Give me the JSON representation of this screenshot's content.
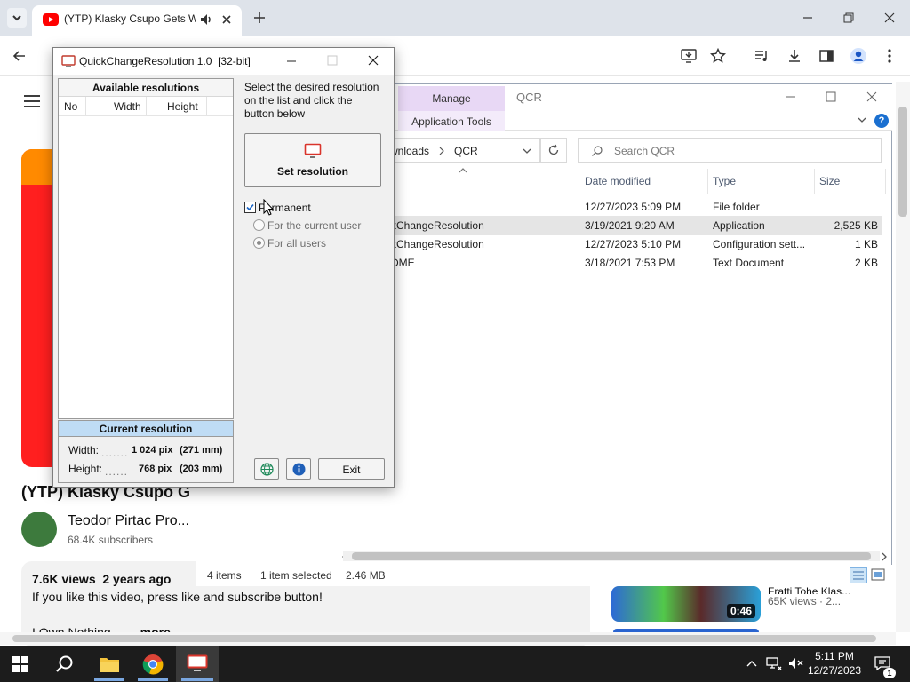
{
  "chrome": {
    "tab_title": "(YTP) Klasky Csupo Gets We",
    "colors": {
      "tabbar": "#dee3ea",
      "youtube_red": "#ff0000"
    }
  },
  "youtube": {
    "video_title": "(YTP) Klasky Csupo G",
    "channel_name": "Teodor Pirtac Pro...",
    "subscribers": "68.4K subscribers",
    "stats": "7.6K views  2 years ago",
    "description": "If you like this video, press like and subscribe button!",
    "description_more_line": "I Own Nothing",
    "more_label": "...more",
    "side_video": {
      "title": "Fratti Tohe Klas...",
      "views": "65K views · 2...",
      "duration": "0:46"
    }
  },
  "explorer": {
    "manage_tab": "Manage",
    "app_tools_tab": "Application Tools",
    "window_title": "QCR",
    "address": {
      "segment1": "wnloads",
      "segment2": "QCR"
    },
    "search_placeholder": "Search QCR",
    "columns": {
      "date": "Date modified",
      "type": "Type",
      "size": "Size"
    },
    "files": [
      {
        "name": "",
        "date": "12/27/2023 5:09 PM",
        "type": "File folder",
        "size": ""
      },
      {
        "name": "kChangeResolution",
        "date": "3/19/2021 9:20 AM",
        "type": "Application",
        "size": "2,525 KB"
      },
      {
        "name": "kChangeResolution",
        "date": "12/27/2023 5:10 PM",
        "type": "Configuration sett...",
        "size": "1 KB"
      },
      {
        "name": "DME",
        "date": "3/18/2021 7:53 PM",
        "type": "Text Document",
        "size": "2 KB"
      }
    ],
    "status": {
      "items": "4 items",
      "selected": "1 item selected",
      "selected_size": "2.46 MB"
    }
  },
  "qcr": {
    "title": "QuickChangeResolution 1.0  [32-bit]",
    "available_header": "Available resolutions",
    "col_no": "No",
    "col_width": "Width",
    "col_height": "Height",
    "instruction": "Select the desired resolution on the list and click the button below",
    "set_button": "Set resolution",
    "permanent_label": "Permanent",
    "permanent_checked": true,
    "radio_current_user": "For the current user",
    "radio_all_users": "For all users",
    "current_header": "Current resolution",
    "width_label": "Width:",
    "width_value": "1 024 pix",
    "width_mm": "(271 mm)",
    "height_label": "Height:",
    "height_value": "768 pix",
    "height_mm": "(203 mm)",
    "exit_button": "Exit"
  },
  "taskbar": {
    "time": "5:11 PM",
    "date": "12/27/2023"
  }
}
